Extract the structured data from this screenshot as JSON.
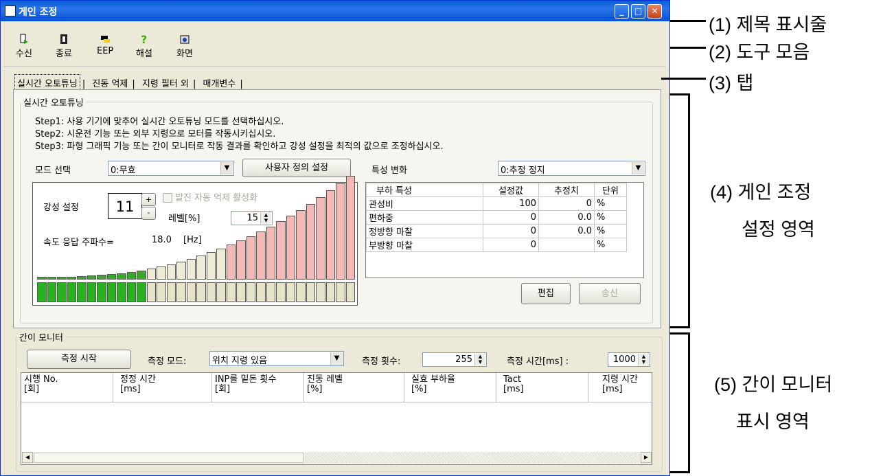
{
  "window": {
    "title": "게인 조정",
    "controls": [
      "minimize",
      "maximize",
      "close"
    ]
  },
  "toolbar": {
    "items": [
      {
        "label": "수신",
        "icon": "receive-icon"
      },
      {
        "label": "종료",
        "icon": "exit-icon"
      },
      {
        "label": "EEP",
        "icon": "eep-icon"
      },
      {
        "label": "해설",
        "icon": "help-icon"
      },
      {
        "label": "화면",
        "icon": "screen-icon"
      }
    ]
  },
  "tabs": [
    "실시간 오토튜닝",
    "진동 억제",
    "지령 필터 외",
    "매개변수"
  ],
  "autotune": {
    "legend": "실시간 오토튜닝",
    "step1": "Step1: 사용 기기에 맞추어 실시간 오토튜닝 모드를 선택하십시오.",
    "step2": "Step2: 시운전 기능 또는 외부 지령으로 모터를 작동시키십시오.",
    "step3": "Step3: 파형 그래픽 기능 또는 간이 모니터로 작동 결과를 확인하고 강성 설정을 최적의 값으로 조정하십시오.",
    "mode_label": "모드 선택",
    "mode_value": "0:무효",
    "custom_button": "사용자 정의 설정",
    "char_label": "특성 변화",
    "char_value": "0:추정 정지",
    "stiffness_label": "강성 설정",
    "stiffness_value": "11",
    "plus": "+",
    "minus": "-",
    "osc_checkbox": "발진 자동 억제 활성화",
    "level_label": "레벨[%]",
    "level_value": "15",
    "speed_label": "속도 응답 주파수=",
    "speed_value": "18.0",
    "speed_unit": "[Hz]",
    "stiffness_bars": {
      "total": 32,
      "selected": 11
    }
  },
  "load_table": {
    "headers": [
      "부하 특성",
      "설정값",
      "추정치",
      "단위"
    ],
    "rows": [
      [
        "관성비",
        "100",
        "0",
        "%"
      ],
      [
        "편하중",
        "0",
        "0.0",
        "%"
      ],
      [
        "정방향 마찰",
        "0",
        "0.0",
        "%"
      ],
      [
        "부방향 마찰",
        "0",
        "",
        "%"
      ]
    ],
    "edit_button": "편집",
    "send_button": "송신"
  },
  "monitor": {
    "legend": "간이 모니터",
    "start_button": "측정 시작",
    "mode_label": "측정 모드:",
    "mode_value": "위치 지령 있음",
    "count_label": "측정 횟수:",
    "count_value": "255",
    "time_label": "측정 시간[ms] :",
    "time_value": "1000",
    "columns": [
      [
        "시행 No.",
        "[회]"
      ],
      [
        "정정 시간",
        "[ms]"
      ],
      [
        "INP를 밑돈 횟수",
        "[회]"
      ],
      [
        "진동 레벨",
        "[%]"
      ],
      [
        "실효 부하율",
        "[%]"
      ],
      [
        "Tact",
        "[ms]"
      ],
      [
        "지령 시간",
        "[ms]"
      ]
    ]
  },
  "annotations": [
    "(1) 제목 표시줄",
    "(2) 도구 모음",
    "(3) 탭",
    "(4) 게인 조정",
    "설정 영역",
    "(5) 간이 모니터",
    "표시 영역"
  ]
}
